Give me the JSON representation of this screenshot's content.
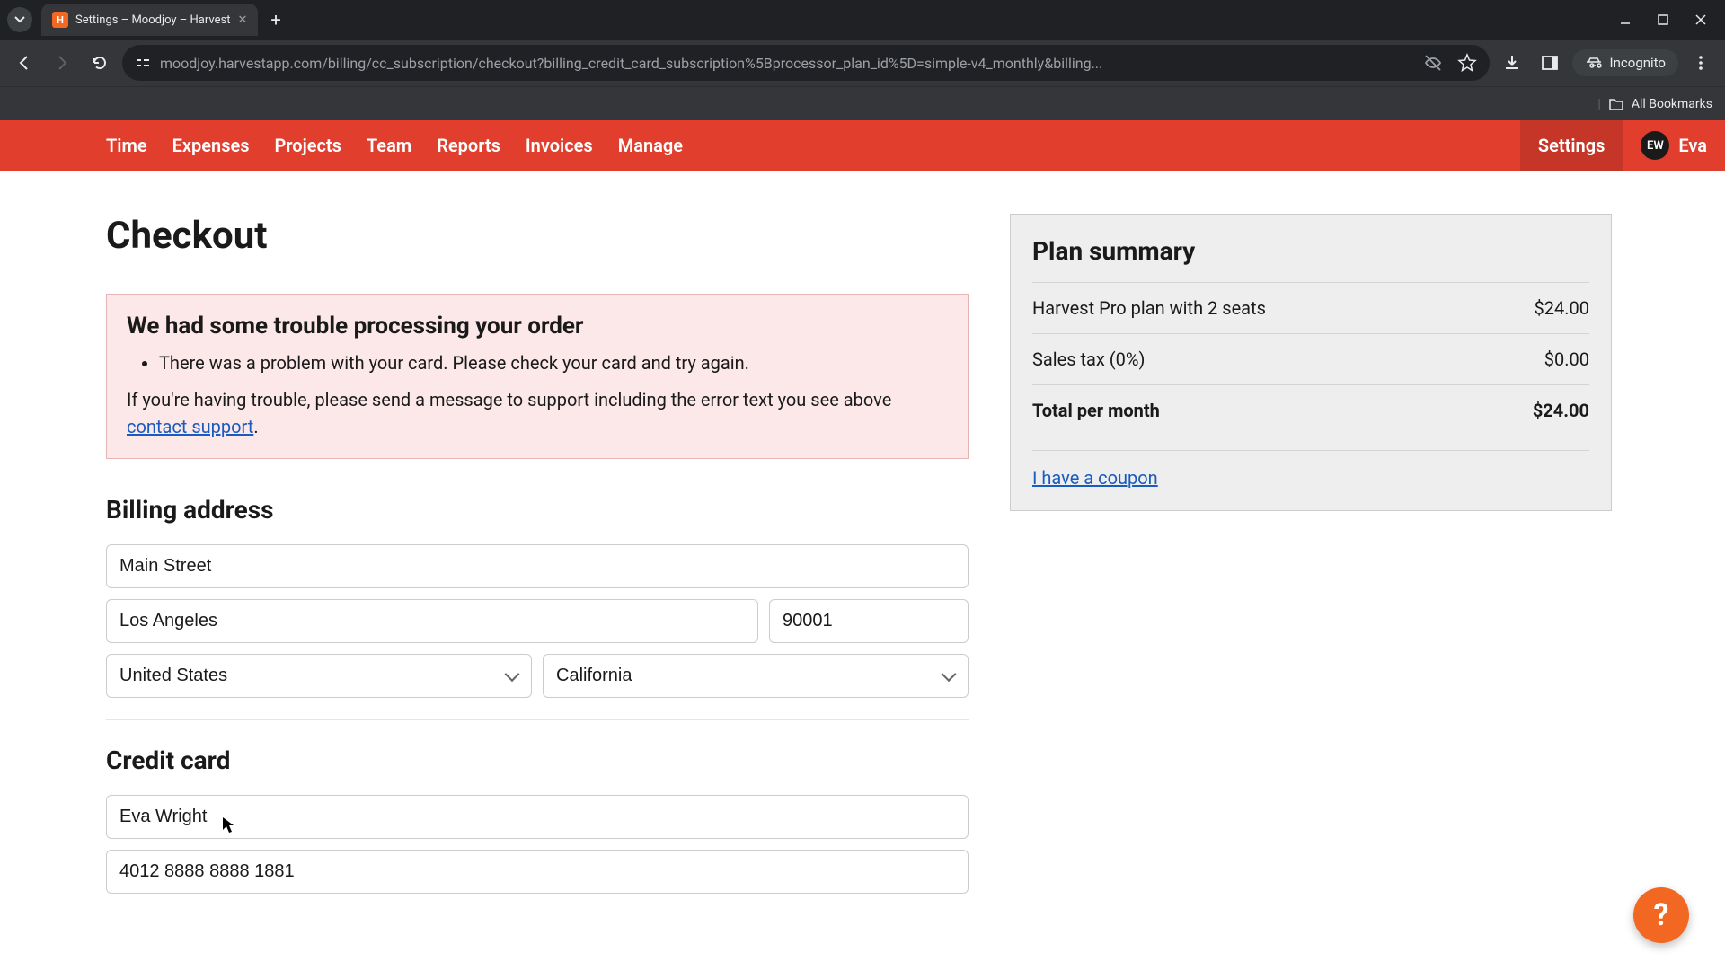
{
  "browser": {
    "tab_title": "Settings – Moodjoy – Harvest",
    "url": "moodjoy.harvestapp.com/billing/cc_subscription/checkout?billing_credit_card_subscription%5Bprocessor_plan_id%5D=simple-v4_monthly&billing...",
    "incognito": "Incognito",
    "all_bookmarks": "All Bookmarks"
  },
  "nav": {
    "items": [
      "Time",
      "Expenses",
      "Projects",
      "Team",
      "Reports",
      "Invoices",
      "Manage"
    ],
    "settings": "Settings",
    "user_initials": "EW",
    "user_name": "Eva"
  },
  "page": {
    "title": "Checkout"
  },
  "error": {
    "title": "We had some trouble processing your order",
    "item": "There was a problem with your card. Please check your card and try again.",
    "footer_before": "If you're having trouble, please send a message to support including the error text you see above ",
    "footer_link": "contact support",
    "footer_after": "."
  },
  "billing": {
    "heading": "Billing address",
    "street": "Main Street",
    "city": "Los Angeles",
    "zip": "90001",
    "country": "United States",
    "state": "California"
  },
  "card": {
    "heading": "Credit card",
    "name": "Eva Wright",
    "number": "4012 8888 8888 1881"
  },
  "plan": {
    "heading": "Plan summary",
    "rows": [
      {
        "label": "Harvest Pro plan with 2 seats",
        "value": "$24.00"
      },
      {
        "label": "Sales tax (0%)",
        "value": "$0.00"
      },
      {
        "label": "Total per month",
        "value": "$24.00"
      }
    ],
    "coupon": "I have a coupon"
  },
  "help": "?"
}
